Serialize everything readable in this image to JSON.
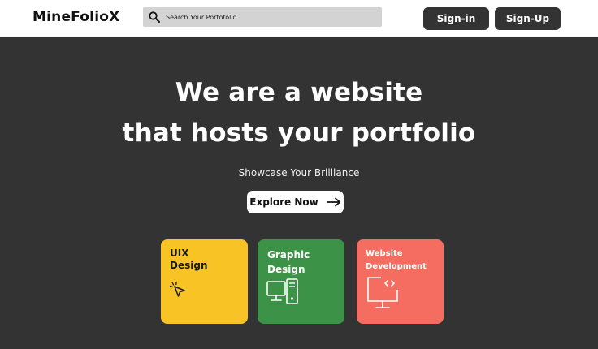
{
  "header": {
    "logo": "MineFolioX",
    "search_placeholder": "Search Your Portofolio",
    "signin_label": "Sign-in",
    "signup_label": "Sign-Up"
  },
  "hero": {
    "line1": "We are a website",
    "line2": "that hosts your portfolio",
    "subtitle": "Showcase Your Brilliance",
    "cta_label": "Explore Now"
  },
  "cards": [
    {
      "line1": "UIX",
      "line2": "Design",
      "icon": "cursor-click-icon",
      "color": "#f7c325"
    },
    {
      "line1": "Graphic",
      "line2": "Design",
      "icon": "computer-devices-icon",
      "color": "#3c9348"
    },
    {
      "line1": "Website",
      "line2": "Development",
      "icon": "code-monitor-icon",
      "color": "#f56d61"
    }
  ],
  "colors": {
    "background": "#333333",
    "header_bg": "#ffffff",
    "search_bg": "#d3d3d3"
  }
}
